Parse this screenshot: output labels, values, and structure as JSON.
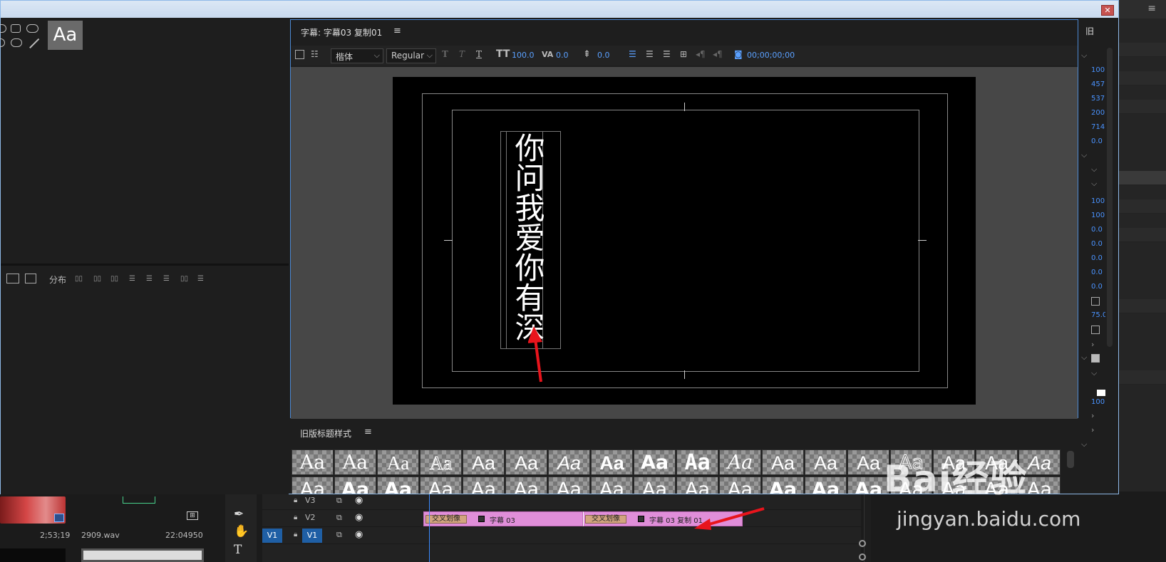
{
  "title_panel": {
    "title": "字幕: 字幕03 复制01",
    "menu": "≡",
    "font_family": "楷体",
    "font_style": "Regular",
    "font_size": "100.0",
    "kerning": "0.0",
    "leading": "0.0",
    "timecode": "00;00;00;00",
    "text_content": "你问我爱你有深"
  },
  "left_panel": {
    "style_preview": "Aa",
    "distribute_label": "分布"
  },
  "styles_panel": {
    "title": "旧版标题样式",
    "menu": "≡",
    "swatch_label": "Aa"
  },
  "properties_panel": {
    "title": "旧",
    "values": [
      "100",
      "457",
      "537",
      "200",
      "714",
      "0.0",
      "100",
      "100",
      "0.0",
      "0.0",
      "0.0",
      "0.0",
      "0.0",
      "75.0",
      "100"
    ]
  },
  "timeline": {
    "tracks": [
      {
        "name": "V3"
      },
      {
        "name": "V2"
      },
      {
        "name": "V1",
        "target": "V1"
      }
    ],
    "clips": [
      {
        "transition": "交叉划像",
        "title": "字幕 03"
      },
      {
        "transition": "交叉划像",
        "title": "字幕 03 复制 01"
      }
    ]
  },
  "project": {
    "timecode_1": "2;53;19",
    "file": "2909.wav",
    "timecode_2": "22:04950"
  },
  "watermark": {
    "logo": "Bai经验",
    "url": "jingyan.baidu.com"
  },
  "colors": {
    "accent": "#4a93ff",
    "clip": "#e08ed9",
    "arrow": "#e8141c"
  }
}
